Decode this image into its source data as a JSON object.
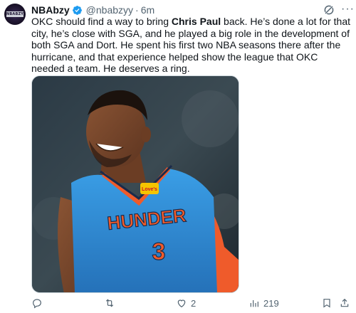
{
  "author": {
    "display_name": "NBAbzy",
    "handle": "@nbabzyy",
    "separator": "·",
    "time": "6m",
    "avatar_text": "NBABZY",
    "verified": true
  },
  "tweet": {
    "text_before": "OKC should find a way to bring ",
    "text_bold": "Chris Paul",
    "text_after": " back. He’s done a lot for that city, he’s close with SGA, and he played a big role in the development of both SGA and Dort. He spent his first two NBA seasons there after the hurricane, and that experience helped show the league that OKC needed a team. He deserves a ring."
  },
  "media": {
    "jersey_text": "HUNDER",
    "jersey_number": "3",
    "patch_text": "Love's"
  },
  "actions": {
    "reply_count": "",
    "retweet_count": "",
    "like_count": "2",
    "views_count": "219"
  },
  "icons": {
    "verified": "verified-badge-icon",
    "grok": "grok-icon",
    "more": "more-icon",
    "reply": "reply-icon",
    "retweet": "retweet-icon",
    "like": "heart-icon",
    "views": "views-icon",
    "bookmark": "bookmark-icon",
    "share": "share-icon"
  },
  "colors": {
    "verified_blue": "#1d9bf0",
    "jersey_blue": "#2f8fd8",
    "jersey_orange": "#ef5b2b",
    "text_secondary": "#536471"
  }
}
